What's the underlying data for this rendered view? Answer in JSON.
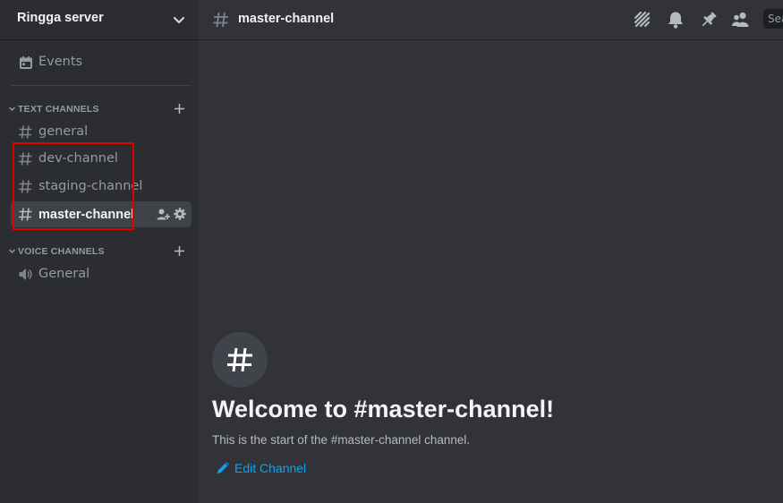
{
  "server": {
    "name": "Ringga server"
  },
  "sidebar": {
    "events_label": "Events",
    "categories": [
      {
        "label": "TEXT CHANNELS",
        "channels": [
          {
            "label": "general"
          },
          {
            "label": "dev-channel"
          },
          {
            "label": "staging-channel"
          },
          {
            "label": "master-channel",
            "active": true
          }
        ]
      },
      {
        "label": "VOICE CHANNELS",
        "channels": [
          {
            "label": "General",
            "icon": "speaker-icon"
          }
        ]
      }
    ]
  },
  "topbar": {
    "channel_name": "master-channel",
    "icons": [
      "threads-icon",
      "bell-icon",
      "pin-icon",
      "members-icon"
    ],
    "search_placeholder": "Search"
  },
  "welcome": {
    "title": "Welcome to #master-channel!",
    "subtitle": "This is the start of the #master-channel channel.",
    "edit_label": "Edit Channel"
  },
  "colors": {
    "background": "#313338",
    "sidebar": "#2b2d31",
    "active_channel": "#404249",
    "link": "#00a8fc",
    "highlight_box": "#e00000"
  }
}
